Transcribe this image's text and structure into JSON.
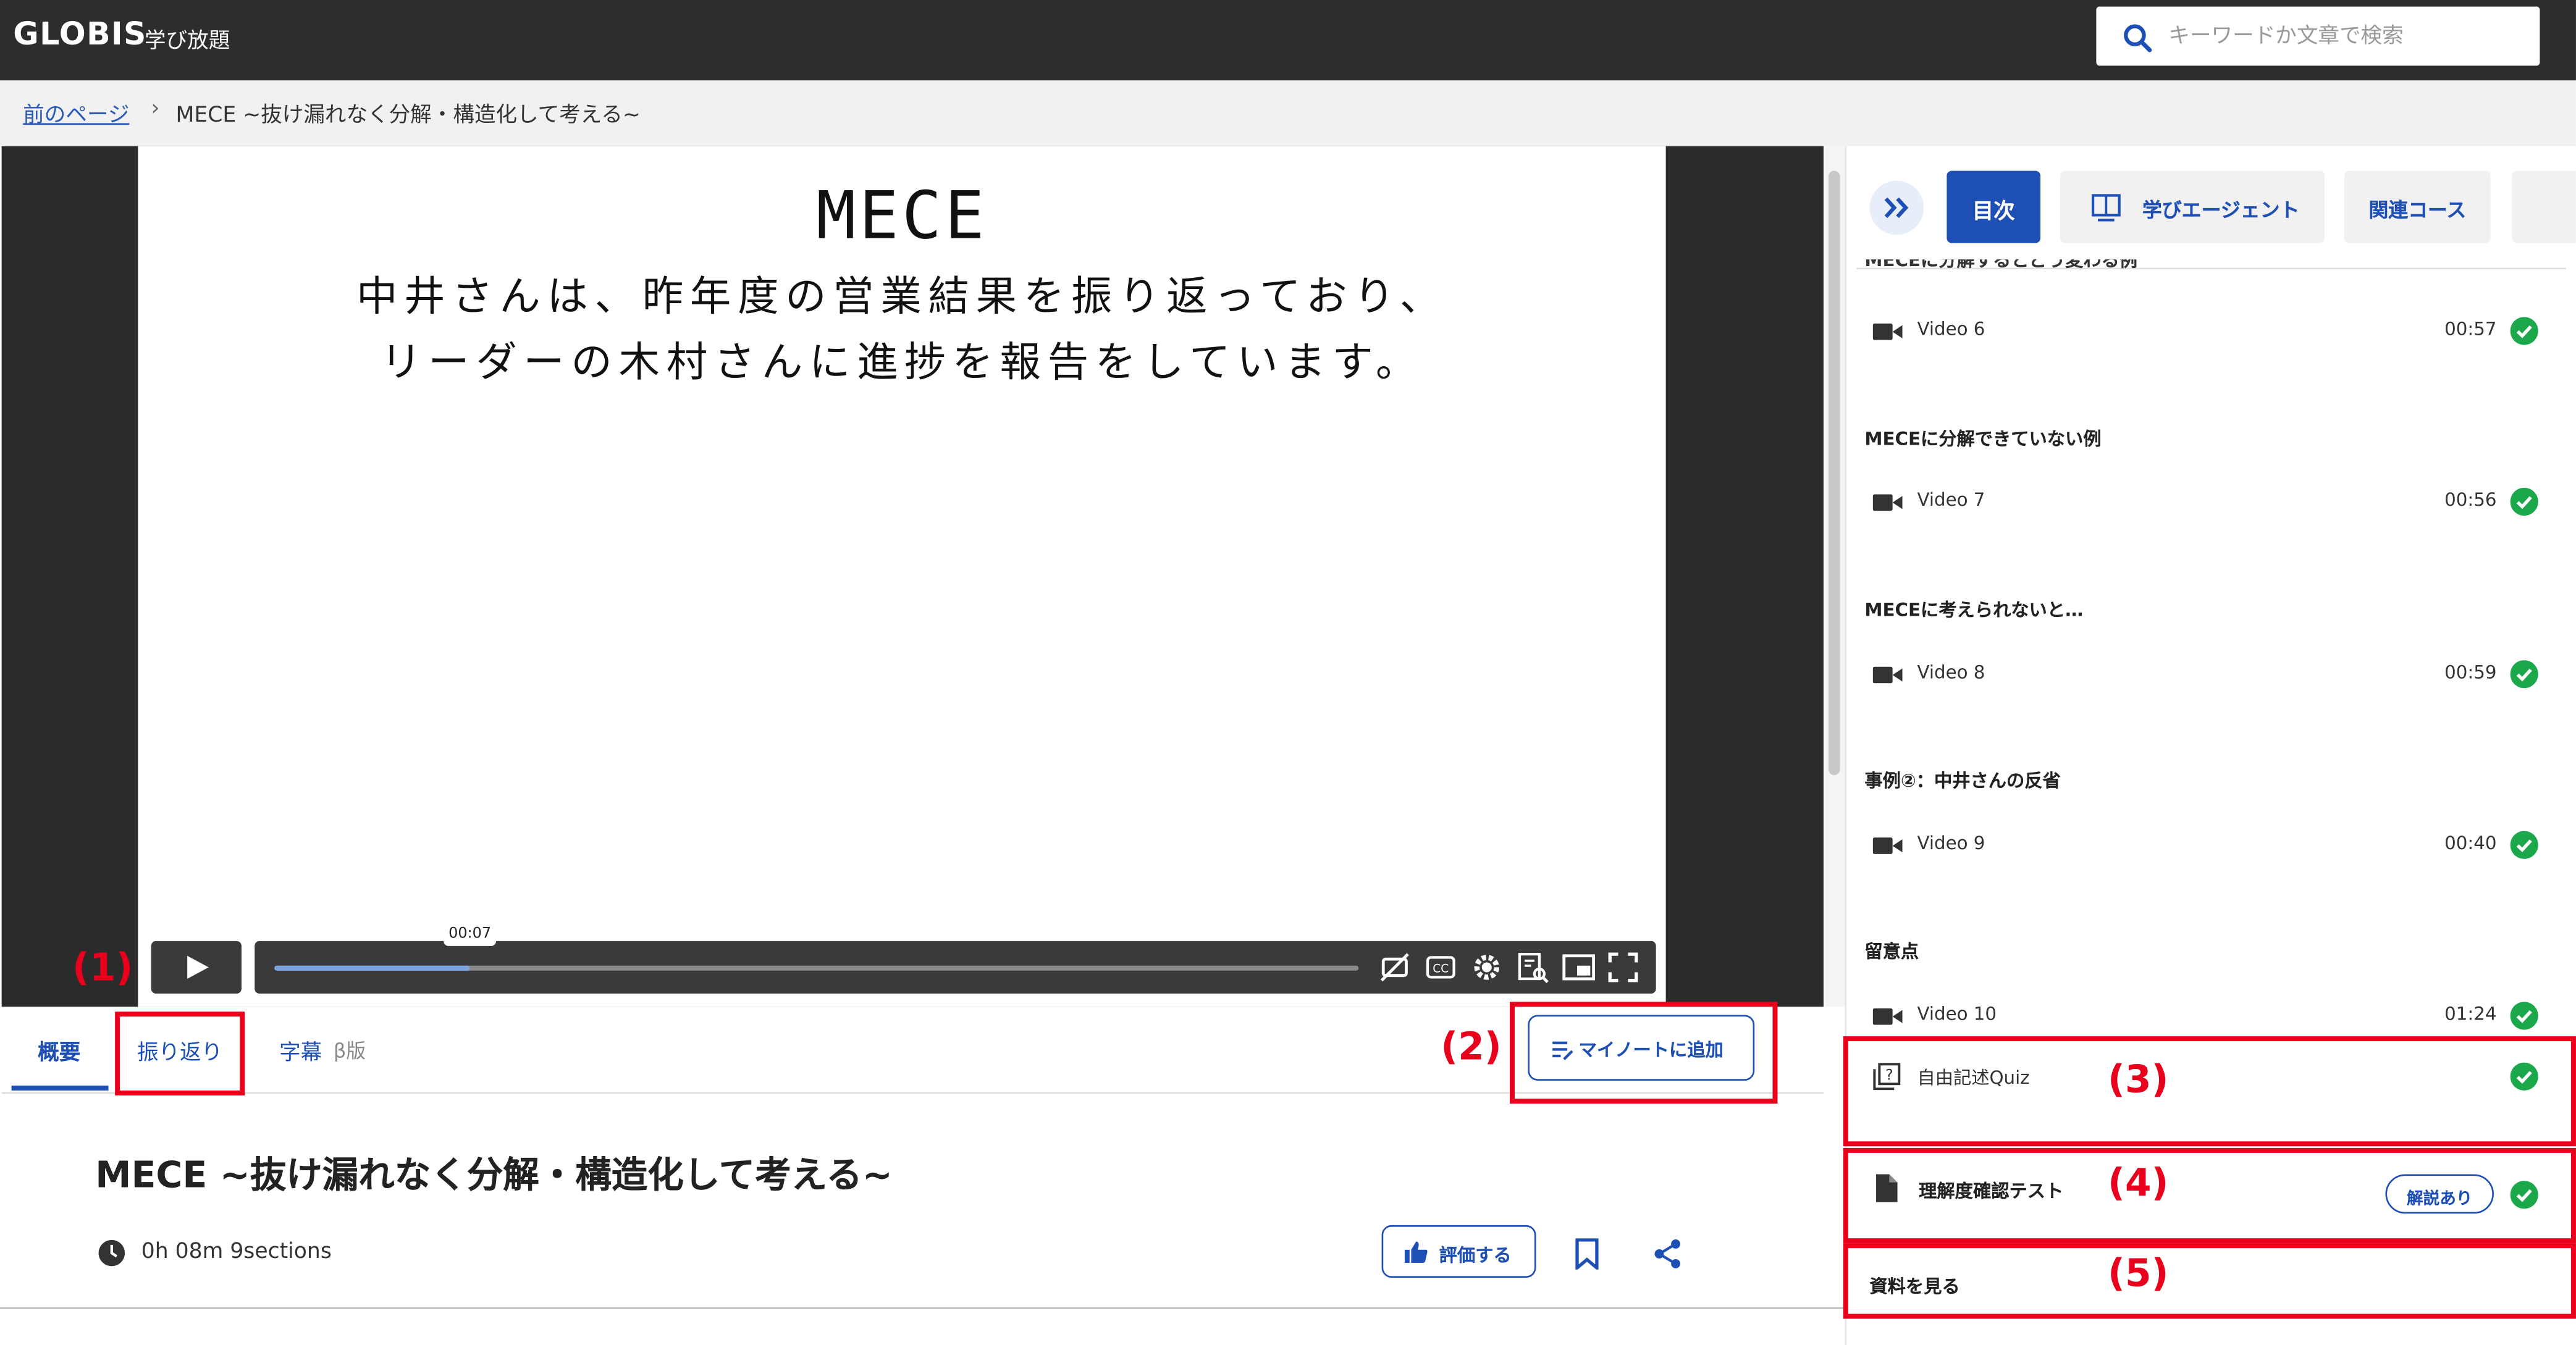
{
  "header": {
    "logo": "GLOBIS",
    "logo_sub": "学び放題",
    "search_placeholder": "キーワードか文章で検索"
  },
  "breadcrumb": {
    "back": "前のページ",
    "separator": "›",
    "current": "MECE ~抜け漏れなく分解・構造化して考える~"
  },
  "video": {
    "slide_heading": "MECE",
    "slide_line1": "中井さんは、昨年度の営業結果を振り返っており、",
    "slide_line2": "リーダーの木村さんに進捗を報告をしています。",
    "current_time": "00:07",
    "progress": 0.18
  },
  "tabs": {
    "overview": "概要",
    "reflection": "振り返り",
    "subtitles": "字幕",
    "beta": "β版"
  },
  "mynote_label": "マイノートに追加",
  "course": {
    "title": "MECE ~抜け漏れなく分解・構造化して考える~",
    "duration": "0h 08m",
    "sections": "9sections",
    "rate_label": "評価する"
  },
  "sidebar": {
    "tabs": {
      "toc": "目次",
      "agent": "学びエージェント",
      "related": "関連コース"
    },
    "cut_heading": "MECEに分解するとどう変わる例",
    "items": [
      {
        "section": "",
        "video": "Video 6",
        "time": "00:57"
      },
      {
        "section": "MECEに分解できていない例",
        "video": "Video 7",
        "time": "00:56"
      },
      {
        "section": "MECEに考えられないと…",
        "video": "Video 8",
        "time": "00:59"
      },
      {
        "section": "事例②：中井さんの反省",
        "video": "Video 9",
        "time": "00:40"
      },
      {
        "section": "留意点",
        "video": "Video 10",
        "time": "01:24"
      }
    ],
    "quiz_label": "自由記述Quiz",
    "test_label": "理解度確認テスト",
    "explain_badge": "解説あり",
    "materials_label": "資料を見る"
  },
  "annotations": [
    "(1)",
    "(2)",
    "(3)",
    "(4)",
    "(5)"
  ],
  "colors": {
    "accent": "#1d4fb5",
    "header": "#2d2d2d",
    "check": "#1aa84a",
    "annotation": "#e8001c"
  }
}
